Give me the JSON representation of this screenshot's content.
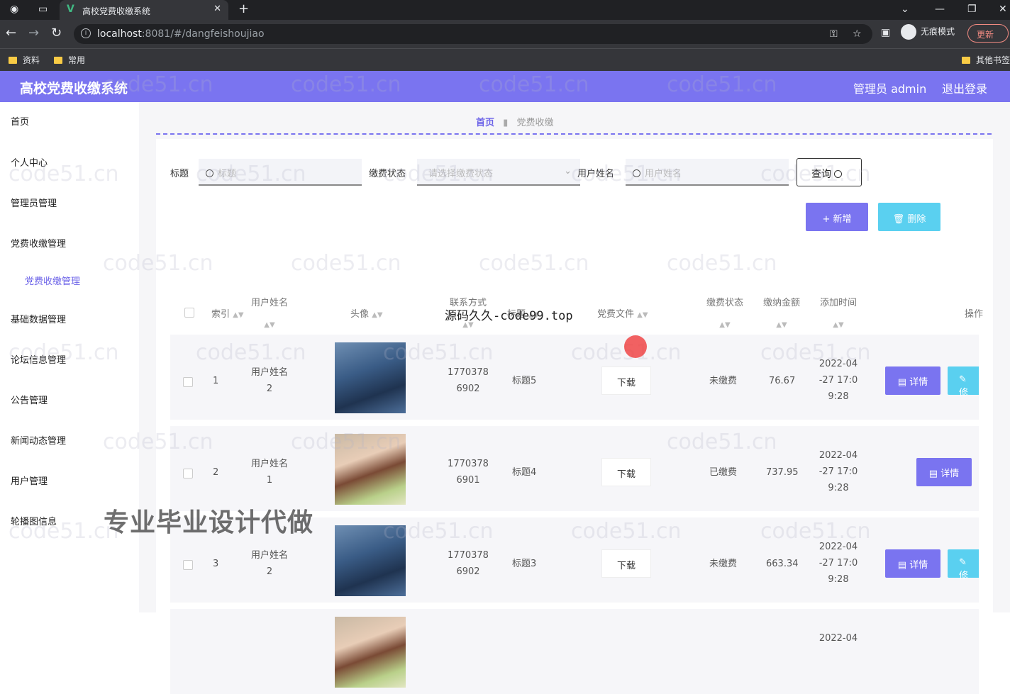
{
  "browser": {
    "tab_title": "高校党费收缴系统",
    "url_host": "localhost",
    "url_rest": ":8081/#/dangfeishoujiao",
    "incognito_label": "无痕模式",
    "update_label": "更新",
    "bookmarks": [
      "资料",
      "常用"
    ],
    "other_bookmarks": "其他书签"
  },
  "app": {
    "title": "高校党费收缴系统",
    "admin_label": "管理员 admin",
    "logout_label": "退出登录",
    "accent": "#7a74f0"
  },
  "sidebar": {
    "items": [
      "首页",
      "个人中心",
      "管理员管理",
      "党费收缴管理",
      "基础数据管理",
      "论坛信息管理",
      "公告管理",
      "新闻动态管理",
      "用户管理",
      "轮播图信息"
    ],
    "sub_item": "党费收缴管理"
  },
  "breadcrumb": {
    "home": "首页",
    "current": "党费收缴"
  },
  "filters": {
    "title_label": "标题",
    "title_placeholder": "标题",
    "status_label": "缴费状态",
    "status_placeholder": "请选择缴费状态",
    "user_label": "用户姓名",
    "user_placeholder": "用户姓名",
    "query_label": "查询"
  },
  "actions": {
    "add_label": "+ 新增",
    "delete_label": "删除"
  },
  "table": {
    "headers": {
      "index": "索引",
      "user": "用户姓名",
      "avatar": "头像",
      "phone": "联系方式",
      "title": "标题",
      "file": "党费文件",
      "status": "缴费状态",
      "amount": "缴纳金额",
      "time": "添加时间",
      "ops": "操作"
    },
    "rows": [
      {
        "index": "1",
        "user_a": "用户姓名",
        "user_b": "2",
        "phone_a": "1770378",
        "phone_b": "6902",
        "title": "标题5",
        "file": "下载",
        "status": "未缴费",
        "amount": "76.67",
        "time_a": "2022-04",
        "time_b": "-27 17:0",
        "time_c": "9:28",
        "detail": "详情",
        "edit": "修"
      },
      {
        "index": "2",
        "user_a": "用户姓名",
        "user_b": "1",
        "phone_a": "1770378",
        "phone_b": "6901",
        "title": "标题4",
        "file": "下载",
        "status": "已缴费",
        "amount": "737.95",
        "time_a": "2022-04",
        "time_b": "-27 17:0",
        "time_c": "9:28",
        "detail": "详情"
      },
      {
        "index": "3",
        "user_a": "用户姓名",
        "user_b": "2",
        "phone_a": "1770378",
        "phone_b": "6902",
        "title": "标题3",
        "file": "下载",
        "status": "未缴费",
        "amount": "663.34",
        "time_a": "2022-04",
        "time_b": "-27 17:0",
        "time_c": "9:28",
        "detail": "详情",
        "edit": "修"
      },
      {
        "time_a": "2022-04"
      }
    ]
  },
  "overlays": {
    "site_text": "源码久久-code99.top",
    "promo_text": "专业毕业设计代做",
    "watermark": "code51.cn"
  }
}
